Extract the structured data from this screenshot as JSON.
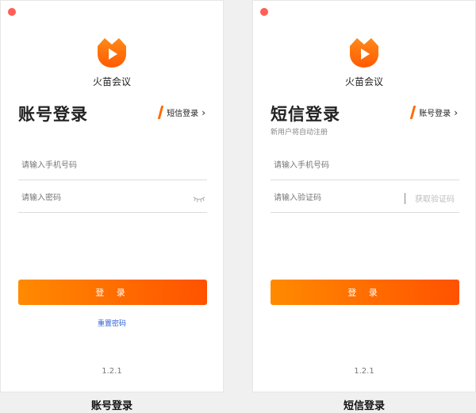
{
  "colors": {
    "accent": "#ff6a00",
    "button_start": "#ff8a00",
    "button_end": "#ff5200",
    "link": "#2f5fd6",
    "close": "#ff5f57"
  },
  "app": {
    "name": "火苗会议",
    "version": "1.2.1",
    "logo_icon": "flame-play-logo-icon"
  },
  "left_panel": {
    "title": "账号登录",
    "switch_label": "短信登录",
    "phone_placeholder": "请输入手机号码",
    "password_placeholder": "请输入密码",
    "password_icon": "eye-closed-icon",
    "login_button": "登 录",
    "reset_link": "重置密码",
    "caption": "账号登录"
  },
  "right_panel": {
    "title": "短信登录",
    "subtitle": "新用户将自动注册",
    "switch_label": "账号登录",
    "phone_placeholder": "请输入手机号码",
    "code_placeholder": "请输入验证码",
    "get_code_button": "获取验证码",
    "login_button": "登 录",
    "caption": "短信登录"
  }
}
